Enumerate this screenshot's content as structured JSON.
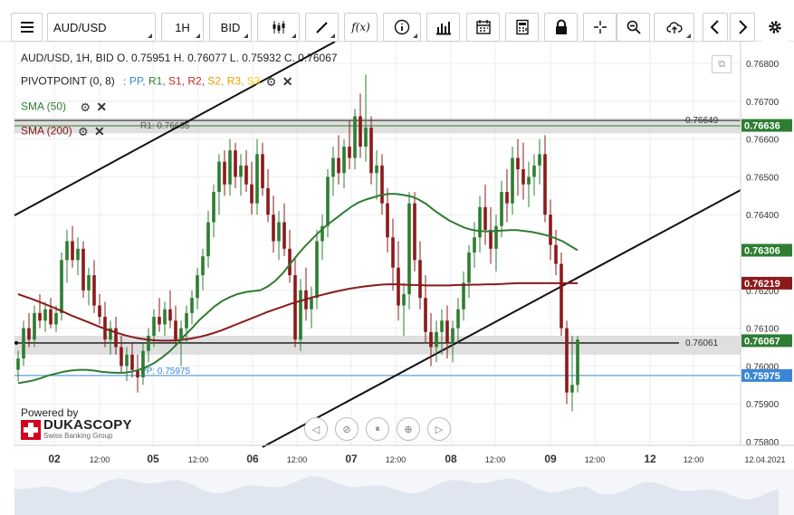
{
  "toolbar": {
    "menu_icon": "hamburger-menu-icon",
    "instrument": "AUD/USD",
    "timeframe": "1H",
    "price_side": "BID",
    "icons": [
      "candle-type-icon",
      "draw-pencil-icon",
      "fx-indicator-icon",
      "info-icon",
      "volume-bars-icon",
      "calendar-icon",
      "calculator-icon",
      "lock-icon",
      "crosshair-icon",
      "zoom-icon",
      "cloud-upload-icon",
      "prev-arrow-icon",
      "next-arrow-icon",
      "settings-gear-icon"
    ],
    "fx_label": "f(x)"
  },
  "legend": {
    "ohlc_line": "AUD/USD, 1H, BID   O. 0.75951  H. 0.76077  L. 0.75932  C. 0.76067",
    "pivot_label": "PIVOTPOINT (0, 8)",
    "pivot_items": [
      {
        "label": "PP,",
        "color": "#3a86d4"
      },
      {
        "label": "R1,",
        "color": "#2e7d32"
      },
      {
        "label": "S1,",
        "color": "#c62828"
      },
      {
        "label": "R2,",
        "color": "#c62828"
      },
      {
        "label": "S2,",
        "color": "#e6a000"
      },
      {
        "label": "R3,",
        "color": "#e6a000"
      },
      {
        "label": "S3",
        "color": "#f0d000"
      }
    ],
    "pivot_prefix": ":",
    "sma50": "SMA (50)",
    "sma200": "SMA (200)"
  },
  "branding": {
    "powered_by": "Powered by",
    "logo_name": "DUKASCOPY",
    "logo_sub": "Swiss Banking Group"
  },
  "nav_controls": [
    "rewind-icon",
    "back-icon",
    "pause-icon",
    "zoom-in-icon",
    "play-icon"
  ],
  "chart_data": {
    "type": "candlestick",
    "y_ticks": [
      "0.76800",
      "0.76700",
      "0.76600",
      "0.76500",
      "0.76400",
      "0.76200",
      "0.76100",
      "0.76000",
      "0.75900",
      "0.75800"
    ],
    "ylim": [
      0.7576,
      0.7685
    ],
    "x_ticks": [
      "02",
      "12:00",
      "05",
      "12:00",
      "06",
      "12:00",
      "07",
      "12:00",
      "08",
      "12:00",
      "09",
      "12:00",
      "12",
      "12:00",
      "12.04.2021"
    ],
    "levels": [
      {
        "label": "R1: 0.76635",
        "value": 0.76635,
        "color": "#2e7d32"
      },
      {
        "label": "PP: 0.75975",
        "value": 0.75975,
        "color": "#3a86d4"
      }
    ],
    "hlines": [
      {
        "label": "0.76649",
        "value": 0.76649
      },
      {
        "label": "0.76061",
        "value": 0.76061
      }
    ],
    "price_badges": [
      {
        "label": "0.76636",
        "value": 0.76636,
        "color": "#2e7d32"
      },
      {
        "label": "0.76306",
        "value": 0.76306,
        "color": "#2e7d32"
      },
      {
        "label": "0.76219",
        "value": 0.76219,
        "color": "#8b1a1a"
      },
      {
        "label": "0.76067",
        "value": 0.76067,
        "color": "#2e7d32"
      },
      {
        "label": "0.75975",
        "value": 0.75975,
        "color": "#3a86d4"
      }
    ],
    "candles_ohlc": [
      [
        0.7599,
        0.7604,
        0.7596,
        0.7602
      ],
      [
        0.7602,
        0.7612,
        0.76,
        0.761
      ],
      [
        0.761,
        0.7614,
        0.7605,
        0.7607
      ],
      [
        0.7607,
        0.7616,
        0.7605,
        0.7614
      ],
      [
        0.7614,
        0.7619,
        0.761,
        0.7612
      ],
      [
        0.7612,
        0.7617,
        0.7609,
        0.7615
      ],
      [
        0.7615,
        0.7618,
        0.761,
        0.7611
      ],
      [
        0.7611,
        0.7616,
        0.7609,
        0.7614
      ],
      [
        0.7614,
        0.763,
        0.7612,
        0.7628
      ],
      [
        0.7628,
        0.7636,
        0.7622,
        0.7633
      ],
      [
        0.7633,
        0.7637,
        0.7626,
        0.7628
      ],
      [
        0.7628,
        0.7634,
        0.7624,
        0.7631
      ],
      [
        0.7631,
        0.7633,
        0.7618,
        0.762
      ],
      [
        0.762,
        0.7626,
        0.7616,
        0.7624
      ],
      [
        0.7624,
        0.7628,
        0.7614,
        0.7616
      ],
      [
        0.7616,
        0.7619,
        0.7611,
        0.7613
      ],
      [
        0.7613,
        0.7617,
        0.7605,
        0.7607
      ],
      [
        0.7607,
        0.7612,
        0.7603,
        0.761
      ],
      [
        0.761,
        0.7613,
        0.7603,
        0.7605
      ],
      [
        0.7605,
        0.7608,
        0.7598,
        0.76
      ],
      [
        0.76,
        0.7605,
        0.7596,
        0.7603
      ],
      [
        0.7603,
        0.7606,
        0.7597,
        0.7599
      ],
      [
        0.7599,
        0.7603,
        0.7593,
        0.7597
      ],
      [
        0.7597,
        0.7606,
        0.7595,
        0.7604
      ],
      [
        0.7604,
        0.761,
        0.7601,
        0.7608
      ],
      [
        0.7608,
        0.7615,
        0.7605,
        0.7613
      ],
      [
        0.7613,
        0.7618,
        0.7609,
        0.7611
      ],
      [
        0.7611,
        0.7617,
        0.7608,
        0.7615
      ],
      [
        0.7615,
        0.762,
        0.761,
        0.7612
      ],
      [
        0.7612,
        0.7616,
        0.7605,
        0.7607
      ],
      [
        0.7607,
        0.7612,
        0.76,
        0.761
      ],
      [
        0.761,
        0.7616,
        0.7606,
        0.7614
      ],
      [
        0.7614,
        0.762,
        0.7611,
        0.7618
      ],
      [
        0.7618,
        0.7626,
        0.7615,
        0.7624
      ],
      [
        0.7624,
        0.7631,
        0.762,
        0.7629
      ],
      [
        0.7629,
        0.7641,
        0.7626,
        0.7638
      ],
      [
        0.7638,
        0.7648,
        0.7634,
        0.7646
      ],
      [
        0.7646,
        0.7656,
        0.764,
        0.7654
      ],
      [
        0.7654,
        0.7657,
        0.7645,
        0.7648
      ],
      [
        0.7648,
        0.766,
        0.7645,
        0.7657
      ],
      [
        0.7657,
        0.7659,
        0.7647,
        0.765
      ],
      [
        0.765,
        0.7656,
        0.7645,
        0.7653
      ],
      [
        0.7653,
        0.7657,
        0.7646,
        0.7648
      ],
      [
        0.7648,
        0.7654,
        0.764,
        0.7643
      ],
      [
        0.7643,
        0.766,
        0.764,
        0.7656
      ],
      [
        0.7656,
        0.7659,
        0.7645,
        0.7647
      ],
      [
        0.7647,
        0.7652,
        0.7638,
        0.764
      ],
      [
        0.764,
        0.7645,
        0.763,
        0.7633
      ],
      [
        0.7633,
        0.7641,
        0.7628,
        0.7638
      ],
      [
        0.7638,
        0.7643,
        0.7629,
        0.7631
      ],
      [
        0.7631,
        0.7636,
        0.7622,
        0.7624
      ],
      [
        0.7624,
        0.7629,
        0.7605,
        0.7607
      ],
      [
        0.7607,
        0.7623,
        0.7604,
        0.762
      ],
      [
        0.762,
        0.7626,
        0.7612,
        0.7615
      ],
      [
        0.7615,
        0.7621,
        0.761,
        0.7618
      ],
      [
        0.7618,
        0.7636,
        0.7615,
        0.7633
      ],
      [
        0.7633,
        0.764,
        0.7628,
        0.7637
      ],
      [
        0.7637,
        0.7652,
        0.7634,
        0.765
      ],
      [
        0.765,
        0.7658,
        0.7645,
        0.7655
      ],
      [
        0.7655,
        0.7661,
        0.7648,
        0.7651
      ],
      [
        0.7651,
        0.766,
        0.7647,
        0.7658
      ],
      [
        0.7658,
        0.7665,
        0.7652,
        0.7655
      ],
      [
        0.7655,
        0.7668,
        0.7652,
        0.7666
      ],
      [
        0.7666,
        0.7672,
        0.7655,
        0.7658
      ],
      [
        0.7658,
        0.7677,
        0.7654,
        0.7663
      ],
      [
        0.7663,
        0.7666,
        0.7648,
        0.7651
      ],
      [
        0.7651,
        0.7657,
        0.7644,
        0.7653
      ],
      [
        0.7653,
        0.7656,
        0.764,
        0.7643
      ],
      [
        0.7643,
        0.7647,
        0.763,
        0.7634
      ],
      [
        0.7634,
        0.7639,
        0.762,
        0.7626
      ],
      [
        0.7626,
        0.7633,
        0.7612,
        0.7616
      ],
      [
        0.7616,
        0.7622,
        0.7608,
        0.7619
      ],
      [
        0.7619,
        0.7646,
        0.7615,
        0.7643
      ],
      [
        0.7643,
        0.7646,
        0.7625,
        0.7628
      ],
      [
        0.7628,
        0.7633,
        0.7615,
        0.7618
      ],
      [
        0.7618,
        0.7624,
        0.7606,
        0.7609
      ],
      [
        0.7609,
        0.7614,
        0.76,
        0.7605
      ],
      [
        0.7605,
        0.7612,
        0.7601,
        0.7609
      ],
      [
        0.7609,
        0.7615,
        0.7603,
        0.7612
      ],
      [
        0.7612,
        0.7616,
        0.7602,
        0.7606
      ],
      [
        0.7606,
        0.7612,
        0.7601,
        0.761
      ],
      [
        0.761,
        0.7618,
        0.7606,
        0.7615
      ],
      [
        0.7615,
        0.7625,
        0.7612,
        0.7622
      ],
      [
        0.7622,
        0.7632,
        0.7618,
        0.763
      ],
      [
        0.763,
        0.7638,
        0.7626,
        0.7634
      ],
      [
        0.7634,
        0.7645,
        0.763,
        0.7642
      ],
      [
        0.7642,
        0.7648,
        0.7632,
        0.7636
      ],
      [
        0.7636,
        0.7642,
        0.7627,
        0.7631
      ],
      [
        0.7631,
        0.764,
        0.7625,
        0.7637
      ],
      [
        0.7637,
        0.7649,
        0.7634,
        0.7646
      ],
      [
        0.7646,
        0.7652,
        0.7638,
        0.7643
      ],
      [
        0.7643,
        0.7658,
        0.764,
        0.7655
      ],
      [
        0.7655,
        0.766,
        0.7645,
        0.7652
      ],
      [
        0.7652,
        0.7659,
        0.7644,
        0.7648
      ],
      [
        0.7648,
        0.7654,
        0.7642,
        0.765
      ],
      [
        0.765,
        0.7656,
        0.7645,
        0.7653
      ],
      [
        0.7653,
        0.766,
        0.7648,
        0.7656
      ],
      [
        0.7656,
        0.7661,
        0.7638,
        0.764
      ],
      [
        0.764,
        0.7644,
        0.7628,
        0.7632
      ],
      [
        0.7632,
        0.7636,
        0.7624,
        0.7627
      ],
      [
        0.7627,
        0.763,
        0.7608,
        0.761
      ],
      [
        0.761,
        0.7612,
        0.759,
        0.7593
      ],
      [
        0.7593,
        0.7608,
        0.7588,
        0.7595
      ],
      [
        0.7595,
        0.7608,
        0.7593,
        0.7607
      ]
    ],
    "sma50": [
      0.75955,
      0.75958,
      0.75962,
      0.75968,
      0.75975,
      0.7598,
      0.75985,
      0.75988,
      0.7599,
      0.7599,
      0.75988,
      0.75985,
      0.75983,
      0.75982,
      0.75982,
      0.75985,
      0.7599,
      0.75998,
      0.76008,
      0.76022,
      0.76038,
      0.76058,
      0.7608,
      0.761,
      0.76122,
      0.7614,
      0.76158,
      0.76172,
      0.76182,
      0.7619,
      0.76195,
      0.76198,
      0.762,
      0.7621,
      0.76225,
      0.76245,
      0.7627,
      0.76295,
      0.76318,
      0.76338,
      0.76358,
      0.76375,
      0.7639,
      0.76405,
      0.7642,
      0.76432,
      0.7644,
      0.76446,
      0.76452,
      0.76455,
      0.76455,
      0.76452,
      0.76448,
      0.7644,
      0.76428,
      0.76412,
      0.76398,
      0.76385,
      0.76375,
      0.76366,
      0.7636,
      0.76357,
      0.76356,
      0.76357,
      0.76358,
      0.76359,
      0.76359,
      0.76357,
      0.76354,
      0.7635,
      0.76345,
      0.76338,
      0.7633,
      0.76318,
      0.76306
    ],
    "sma200": [
      0.7619,
      0.76183,
      0.76176,
      0.76168,
      0.7616,
      0.76152,
      0.76143,
      0.76134,
      0.76126,
      0.76118,
      0.7611,
      0.76102,
      0.76095,
      0.76088,
      0.76082,
      0.76077,
      0.76073,
      0.7607,
      0.76068,
      0.76067,
      0.76067,
      0.76068,
      0.7607,
      0.76073,
      0.76077,
      0.76082,
      0.76088,
      0.76095,
      0.76103,
      0.76111,
      0.76119,
      0.76127,
      0.76135,
      0.76143,
      0.7615,
      0.76157,
      0.76164,
      0.7617,
      0.76176,
      0.76182,
      0.76187,
      0.76192,
      0.76197,
      0.76201,
      0.76205,
      0.76208,
      0.76211,
      0.76213,
      0.76215,
      0.76216,
      0.76216,
      0.76215,
      0.76214,
      0.76214,
      0.76213,
      0.76213,
      0.76213,
      0.76213,
      0.76214,
      0.76214,
      0.76215,
      0.76215,
      0.76216,
      0.76216,
      0.76217,
      0.76218,
      0.76219,
      0.76219,
      0.76219,
      0.76219,
      0.76219,
      0.76219,
      0.76219,
      0.76219,
      0.76219
    ]
  }
}
